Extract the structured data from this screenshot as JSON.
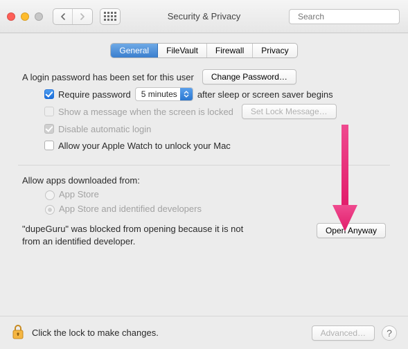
{
  "window": {
    "title": "Security & Privacy",
    "search_placeholder": "Search"
  },
  "tabs": [
    {
      "label": "General",
      "active": true
    },
    {
      "label": "FileVault",
      "active": false
    },
    {
      "label": "Firewall",
      "active": false
    },
    {
      "label": "Privacy",
      "active": false
    }
  ],
  "login": {
    "password_set_text": "A login password has been set for this user",
    "change_password_label": "Change Password…",
    "require_password_label": "Require password",
    "require_password_delay": "5 minutes",
    "require_password_suffix": "after sleep or screen saver begins",
    "show_message_label": "Show a message when the screen is locked",
    "set_lock_message_label": "Set Lock Message…",
    "disable_auto_login_label": "Disable automatic login",
    "apple_watch_label": "Allow your Apple Watch to unlock your Mac"
  },
  "downloads": {
    "heading": "Allow apps downloaded from:",
    "option_appstore": "App Store",
    "option_identified": "App Store and identified developers"
  },
  "blocked": {
    "message": "\"dupeGuru\" was blocked from opening because it is not from an identified developer.",
    "open_anyway_label": "Open Anyway"
  },
  "footer": {
    "lock_text": "Click the lock to make changes.",
    "advanced_label": "Advanced…",
    "help_label": "?"
  },
  "colors": {
    "accent": "#2a77d0",
    "arrow": "#e9307e"
  }
}
